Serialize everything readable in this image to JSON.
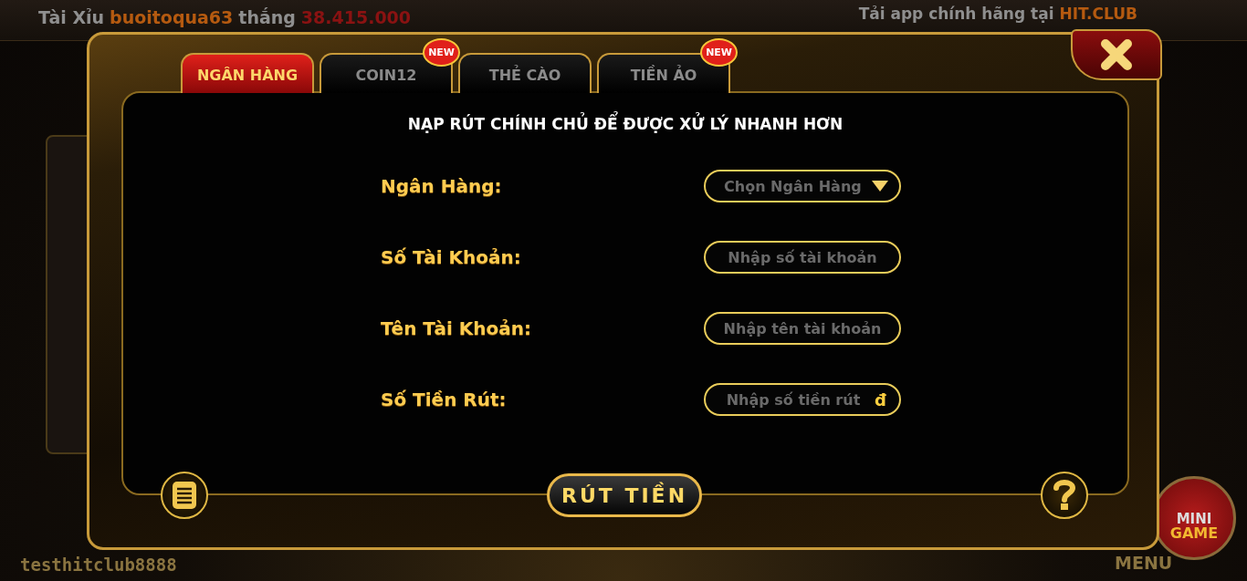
{
  "ticker": {
    "game": "Tài Xỉu",
    "player": "buoitoqua63",
    "verb": "thắng",
    "amount": "38.415.000"
  },
  "promo": {
    "text": "Tải app chính hãng tại",
    "brand": "HIT.CLUB"
  },
  "username": "testhitclub8888",
  "mini_game": {
    "line1": "MINI",
    "line2": "GAME"
  },
  "menu": "MENU",
  "dialog": {
    "tabs": [
      {
        "label": "NGÂN HÀNG",
        "selected": true
      },
      {
        "label": "COIN12",
        "selected": false,
        "badge": "NEW"
      },
      {
        "label": "THẺ CÀO",
        "selected": false
      },
      {
        "label": "TIỀN ẢO",
        "selected": false,
        "badge": "NEW"
      }
    ],
    "notice": "NẠP RÚT CHÍNH CHỦ ĐỂ ĐƯỢC XỬ LÝ NHANH HƠN",
    "fields": [
      {
        "kind": "select",
        "label": "Ngân Hàng:",
        "placeholder": "Chọn Ngân Hàng"
      },
      {
        "kind": "input",
        "label": "Số Tài Khoản:",
        "placeholder": "Nhập số tài khoản"
      },
      {
        "kind": "input",
        "label": "Tên Tài Khoản:",
        "placeholder": "Nhập tên tài khoản"
      },
      {
        "kind": "input",
        "label": "Số Tiền Rút:",
        "placeholder": "Nhập số tiền rút",
        "suffix": "đ"
      }
    ],
    "submit": "RÚT TIỀN"
  }
}
